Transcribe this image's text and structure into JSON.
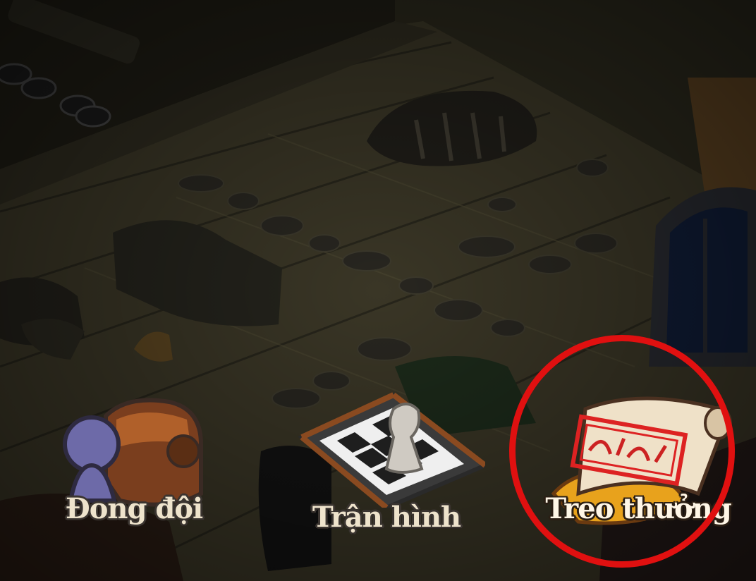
{
  "menu": {
    "team_label": "Đong đội",
    "formation_label": "Trận hình",
    "bounty_label": "Treo thưởng"
  },
  "highlight_color": "#e01010"
}
